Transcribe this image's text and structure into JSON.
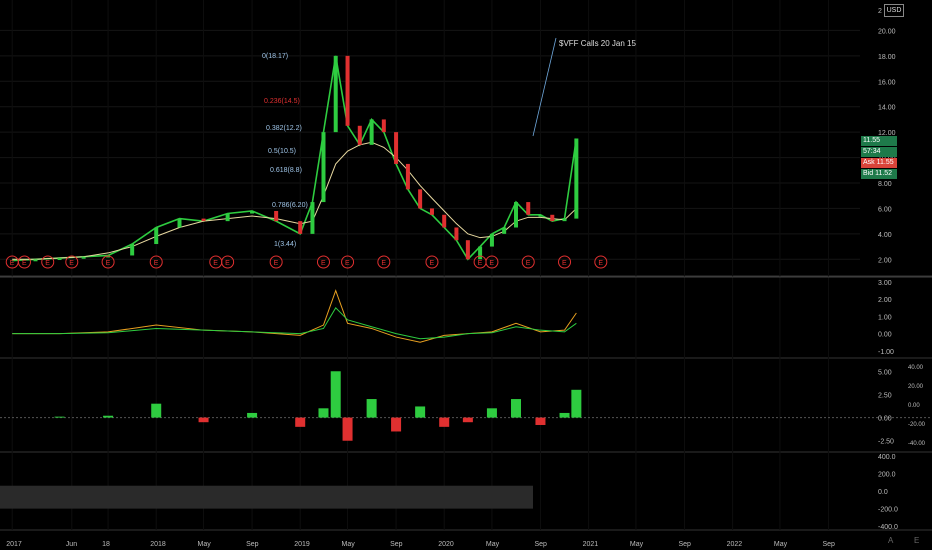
{
  "currency": "USD",
  "annotation": "$VFF Calls 20 Jan 15",
  "price_tags": {
    "last": "11.55",
    "countdown": "57:34",
    "ask_label": "Ask",
    "ask": "11.55",
    "bid_label": "Bid",
    "bid": "11.52"
  },
  "colors": {
    "up": "#2ecc40",
    "down": "#e03030",
    "ma_slow": "#e8d9a0",
    "ma_fast": "#2ecc40",
    "line_blue": "#6fa8dc",
    "bg": "#000000"
  },
  "fib_labels": [
    "0(18.17)",
    "0.236(14.5)",
    "0.382(12.2)",
    "0.5(10.5)",
    "0.618(8.8)",
    "0.786(6.20)",
    "1(3.44)"
  ],
  "earnings_marker": "E",
  "bottom_buttons": [
    "A",
    "E"
  ],
  "chart_data": [
    {
      "type": "line",
      "name_role": "price-pane",
      "x": [
        "2017-01",
        "2017-03",
        "2017-05",
        "2017-07",
        "2017-09",
        "2017-11",
        "2018-01",
        "2018-03",
        "2018-05",
        "2018-07",
        "2018-09",
        "2018-11",
        "2019-01",
        "2019-02",
        "2019-03",
        "2019-04",
        "2019-05",
        "2019-06",
        "2019-07",
        "2019-08",
        "2019-09",
        "2019-10",
        "2019-11",
        "2019-12",
        "2020-01",
        "2020-02",
        "2020-03",
        "2020-04",
        "2020-05",
        "2020-06",
        "2020-07",
        "2020-08",
        "2020-09",
        "2020-10",
        "2020-11",
        "2020-12"
      ],
      "series": [
        {
          "values": [
            1.9,
            2.0,
            2.1,
            2.2,
            2.3,
            3.2,
            4.5,
            5.2,
            5.0,
            5.6,
            5.8,
            5.0,
            4.0,
            6.5,
            12.0,
            18.0,
            12.5,
            11.0,
            13.0,
            12.0,
            9.5,
            7.5,
            6.0,
            5.5,
            4.5,
            3.5,
            2.0,
            3.0,
            4.0,
            4.5,
            6.5,
            5.5,
            5.5,
            5.0,
            5.2,
            11.5
          ]
        },
        {
          "values": [
            2.0,
            2.0,
            2.1,
            2.2,
            2.5,
            3.0,
            3.8,
            4.5,
            5.0,
            5.2,
            5.4,
            5.2,
            4.8,
            5.0,
            7.0,
            9.5,
            10.5,
            11.0,
            11.2,
            10.8,
            10.0,
            9.0,
            7.8,
            6.8,
            5.8,
            4.8,
            4.0,
            3.7,
            3.8,
            4.2,
            5.0,
            5.3,
            5.3,
            5.2,
            5.1,
            6.0
          ]
        }
      ],
      "yticks": [
        "2.00",
        "4.00",
        "6.00",
        "8.00",
        "10.00",
        "12.00",
        "14.00",
        "16.00",
        "18.00",
        "20.00",
        "2"
      ],
      "ylim": [
        1,
        22
      ]
    },
    {
      "type": "line",
      "name_role": "oscillator-1",
      "x": [
        "2017-01",
        "2017-05",
        "2017-09",
        "2018-01",
        "2018-05",
        "2018-09",
        "2019-01",
        "2019-03",
        "2019-04",
        "2019-05",
        "2019-07",
        "2019-09",
        "2019-11",
        "2020-01",
        "2020-03",
        "2020-05",
        "2020-07",
        "2020-09",
        "2020-11",
        "2020-12"
      ],
      "series": [
        {
          "values": [
            0.0,
            0.0,
            0.1,
            0.5,
            0.2,
            0.1,
            -0.1,
            0.5,
            2.5,
            0.6,
            0.3,
            -0.2,
            -0.5,
            -0.1,
            0.0,
            0.1,
            0.6,
            0.1,
            0.2,
            1.2
          ]
        },
        {
          "values": [
            0.0,
            0.0,
            0.05,
            0.3,
            0.2,
            0.1,
            0.0,
            0.3,
            1.5,
            0.8,
            0.4,
            0.0,
            -0.3,
            -0.2,
            0.0,
            0.05,
            0.4,
            0.2,
            0.1,
            0.6
          ]
        }
      ],
      "yticks": [
        "3.00",
        "2.00",
        "1.00",
        "0.00",
        "-1.00"
      ],
      "ylim": [
        -1.3,
        3.0
      ]
    },
    {
      "type": "bar",
      "name_role": "oscillator-2",
      "x": [
        "2017-01",
        "2017-05",
        "2017-09",
        "2018-01",
        "2018-05",
        "2018-09",
        "2019-01",
        "2019-03",
        "2019-04",
        "2019-05",
        "2019-07",
        "2019-09",
        "2019-11",
        "2020-01",
        "2020-03",
        "2020-05",
        "2020-07",
        "2020-09",
        "2020-11",
        "2020-12"
      ],
      "values": [
        0.0,
        0.1,
        0.2,
        1.5,
        -0.5,
        0.5,
        -1.0,
        1.0,
        5.0,
        -2.5,
        2.0,
        -1.5,
        1.2,
        -1.0,
        -0.5,
        1.0,
        2.0,
        -0.8,
        0.5,
        3.0
      ],
      "yticks_left": [
        "5.00",
        "2.50",
        "0.00",
        "-2.50"
      ],
      "yticks_right": [
        "40.00",
        "20.00",
        "0.00",
        "-20.00",
        "-40.00"
      ],
      "ylim": [
        -3.5,
        6.0
      ]
    },
    {
      "type": "line",
      "name_role": "oscillator-3",
      "yticks": [
        "400.0",
        "200.0",
        "0.0",
        "-200.0",
        "-400.0"
      ],
      "ylim": [
        -420,
        420
      ]
    }
  ],
  "xticks": [
    "2017",
    "Jun",
    "18",
    "2018",
    "May",
    "Sep",
    "2019",
    "May",
    "Sep",
    "2020",
    "May",
    "Sep",
    "2021",
    "May",
    "Sep",
    "2022",
    "May",
    "Sep"
  ],
  "xtick_positions_dates": [
    "2017-01",
    "2017-06",
    "2017-09",
    "2018-01",
    "2018-05",
    "2018-09",
    "2019-01",
    "2019-05",
    "2019-09",
    "2020-01",
    "2020-05",
    "2020-09",
    "2021-01",
    "2021-05",
    "2021-09",
    "2022-01",
    "2022-05",
    "2022-09"
  ]
}
